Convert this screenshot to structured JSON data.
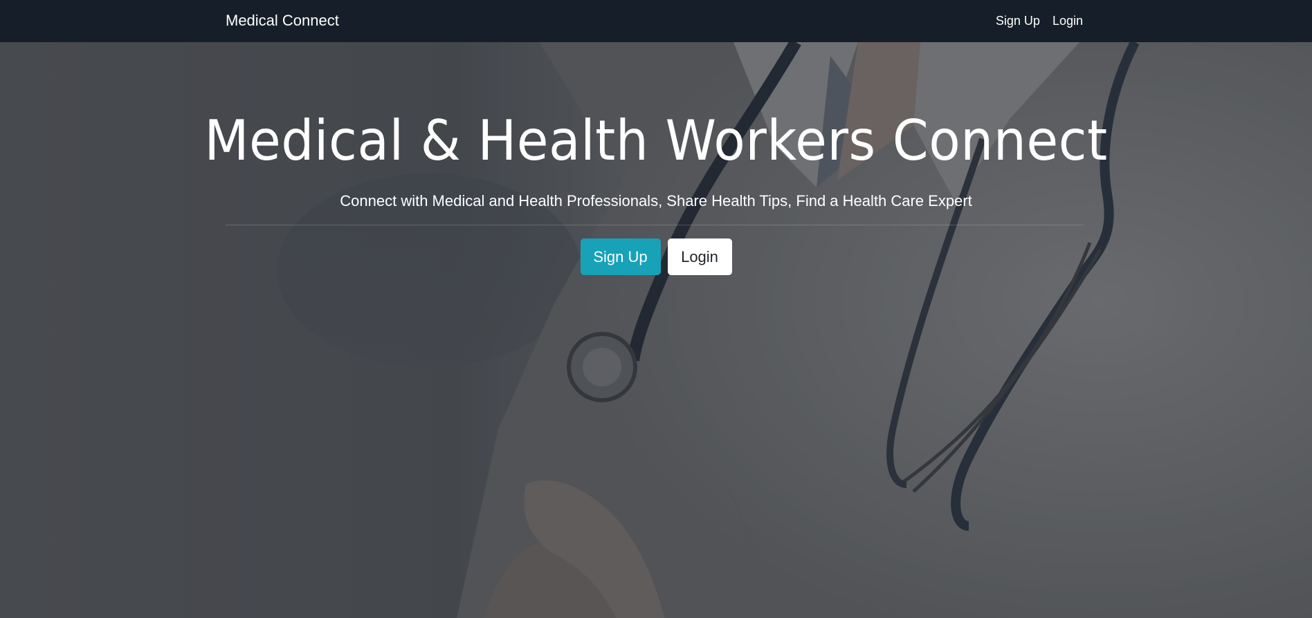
{
  "navbar": {
    "brand": "Medical Connect",
    "links": [
      "Sign Up",
      "Login"
    ]
  },
  "hero": {
    "title": "Medical & Health Workers Connect",
    "subtitle": "Connect with Medical and Health Professionals, Share Health Tips, Find a Health Care Expert",
    "buttons": {
      "signup": "Sign Up",
      "login": "Login"
    },
    "background_image": "doctor-with-stethoscope-photo"
  },
  "colors": {
    "navbar_bg": "#161f29",
    "signup_button": "#17a2b8",
    "login_button": "#ffffff",
    "overlay": "#3a3d42"
  }
}
